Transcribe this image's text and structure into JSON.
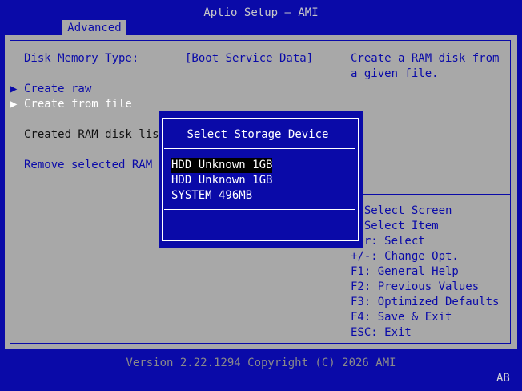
{
  "header": {
    "title": "Aptio Setup – AMI",
    "tab_label": "Advanced"
  },
  "settings": {
    "disk_memory_type_label": "Disk Memory Type:",
    "disk_memory_type_value": "[Boot Service Data]",
    "create_raw": "Create raw",
    "create_from_file": "Create from file",
    "created_list_label": "Created RAM disk list",
    "remove_selected_label": "Remove selected RAM d"
  },
  "help": {
    "line1": "Create a RAM disk from",
    "line2": "a given file."
  },
  "keys": [
    ": Select Screen",
    ": Select Item",
    "ter: Select",
    "+/-: Change Opt.",
    "F1: General Help",
    "F2: Previous Values",
    "F3: Optimized Defaults",
    "F4: Save & Exit",
    "ESC: Exit"
  ],
  "dialog": {
    "title": "Select Storage Device",
    "options": [
      "HDD Unknown 1GB",
      "HDD Unknown 1GB",
      "SYSTEM 496MB"
    ],
    "selected_index": 0
  },
  "footer": {
    "version": "Version 2.22.1294 Copyright (C) 2026 AMI",
    "indicator": "AB"
  },
  "colors": {
    "background": "#0a0aa8",
    "panel": "#a8a8a8",
    "highlight": "#000000",
    "text_light": "#ffffff"
  }
}
